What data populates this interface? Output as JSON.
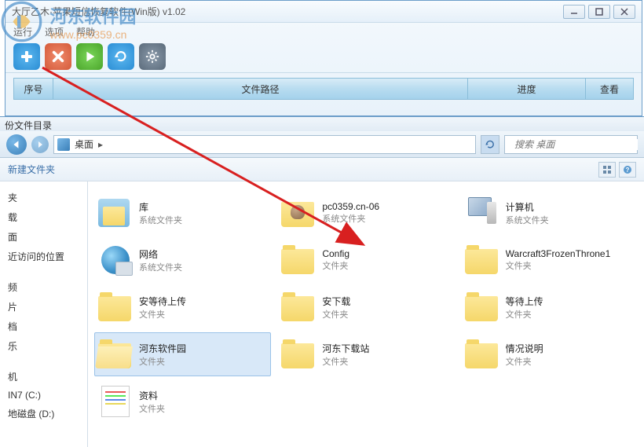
{
  "watermark": {
    "title": "河东软件园",
    "url": "www.pc0359.cn"
  },
  "app": {
    "title": "大厅乙木·苹果短信恢复软件(Win版)  v1.02",
    "menu": {
      "run": "运行",
      "opts": "选项",
      "help": "帮助"
    },
    "table": {
      "seq": "序号",
      "path": "文件路径",
      "progress": "进度",
      "view": "查看"
    }
  },
  "explorer": {
    "title_prefix": "份文件目录",
    "crumb": "桌面",
    "crumb_sep": "▸",
    "search_placeholder": "搜索 桌面",
    "new_folder": "新建文件夹",
    "sidebar": {
      "items": [
        "夹",
        "载",
        "面",
        "近访问的位置"
      ],
      "items2": [
        "频",
        "片",
        "档",
        "乐"
      ],
      "items3": [
        "机",
        "IN7 (C:)",
        "地磁盘 (D:)"
      ]
    },
    "type_sys": "系统文件夹",
    "type_folder": "文件夹",
    "items": [
      {
        "name": "库",
        "type": "系统文件夹",
        "icon": "lib"
      },
      {
        "name": "pc0359.cn-06",
        "type": "系统文件夹",
        "icon": "user"
      },
      {
        "name": "计算机",
        "type": "系统文件夹",
        "icon": "pc"
      },
      {
        "name": "网络",
        "type": "系统文件夹",
        "icon": "net"
      },
      {
        "name": "Config",
        "type": "文件夹",
        "icon": "folder"
      },
      {
        "name": "Warcraft3FrozenThrone1",
        "type": "文件夹",
        "icon": "folder"
      },
      {
        "name": "安等待上传",
        "type": "文件夹",
        "icon": "folder"
      },
      {
        "name": "安下载",
        "type": "文件夹",
        "icon": "folder"
      },
      {
        "name": "等待上传",
        "type": "文件夹",
        "icon": "folder"
      },
      {
        "name": "河东软件园",
        "type": "文件夹",
        "icon": "folder-open",
        "selected": true
      },
      {
        "name": "河东下载站",
        "type": "文件夹",
        "icon": "folder"
      },
      {
        "name": "情况说明",
        "type": "文件夹",
        "icon": "folder"
      },
      {
        "name": "资料",
        "type": "文件夹",
        "icon": "doc"
      }
    ]
  }
}
